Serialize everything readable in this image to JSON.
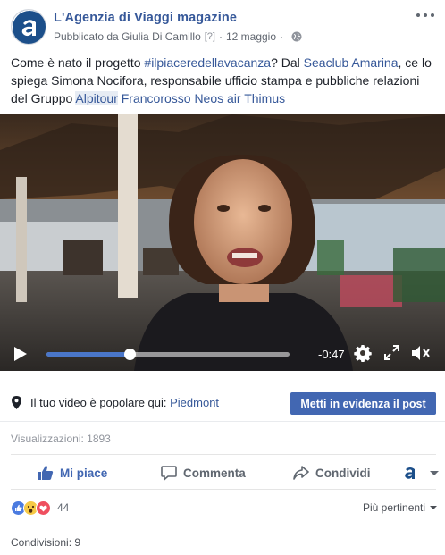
{
  "post": {
    "page_name": "L'Agenzia di Viaggi magazine",
    "published_by": "Pubblicato da Giulia Di Camillo",
    "help_marker": "[?]",
    "separator": "·",
    "date": "12 maggio",
    "text": {
      "part1": "Come è nato il progetto ",
      "hashtag": "#ilpiaceredellavacanza",
      "part2": "? Dal ",
      "mention_seaclub": "Seaclub Amarina",
      "part3": ", ce lo spiega Simona Nocifora, responsabile ufficio stampa e pubbliche relazioni del Gruppo ",
      "mention_alpitour": "Alpitour",
      "space": " ",
      "mention_rest": "Francorosso Neos air Thimus"
    }
  },
  "video": {
    "time_remaining": "-0:47",
    "progress": 0.345
  },
  "popular": {
    "label": "Il tuo video è popolare qui: ",
    "location": "Piedmont",
    "boost_label": "Metti in evidenza il post"
  },
  "stats": {
    "views": "Visualizzazioni: 1893",
    "reaction_count": "44",
    "sort_label": "Più pertinenti",
    "shares": "Condivisioni: 9"
  },
  "actions": {
    "like": "Mi piace",
    "comment": "Commenta",
    "share": "Condividi"
  },
  "colors": {
    "link": "#365899",
    "primary": "#4267b2",
    "progress_fill": "#4a76c9"
  }
}
